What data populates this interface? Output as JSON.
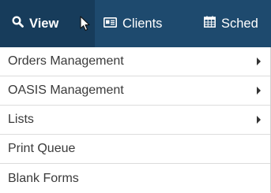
{
  "nav": {
    "items": [
      {
        "label": "View",
        "icon": "search-icon",
        "active": true
      },
      {
        "label": "Clients",
        "icon": "id-card-icon"
      },
      {
        "label": "Sched",
        "icon": "calendar-icon"
      }
    ]
  },
  "menu": {
    "items": [
      {
        "label": "Orders Management",
        "has_submenu": true
      },
      {
        "label": "OASIS Management",
        "has_submenu": true
      },
      {
        "label": "Lists",
        "has_submenu": true
      },
      {
        "label": "Print Queue",
        "has_submenu": false
      },
      {
        "label": "Blank Forms",
        "has_submenu": false
      }
    ]
  },
  "colors": {
    "topbar": "#1e4a6e",
    "topbar_active": "#173c5b",
    "menu_text": "#3a3a3a",
    "divider": "#dcdcdc"
  }
}
